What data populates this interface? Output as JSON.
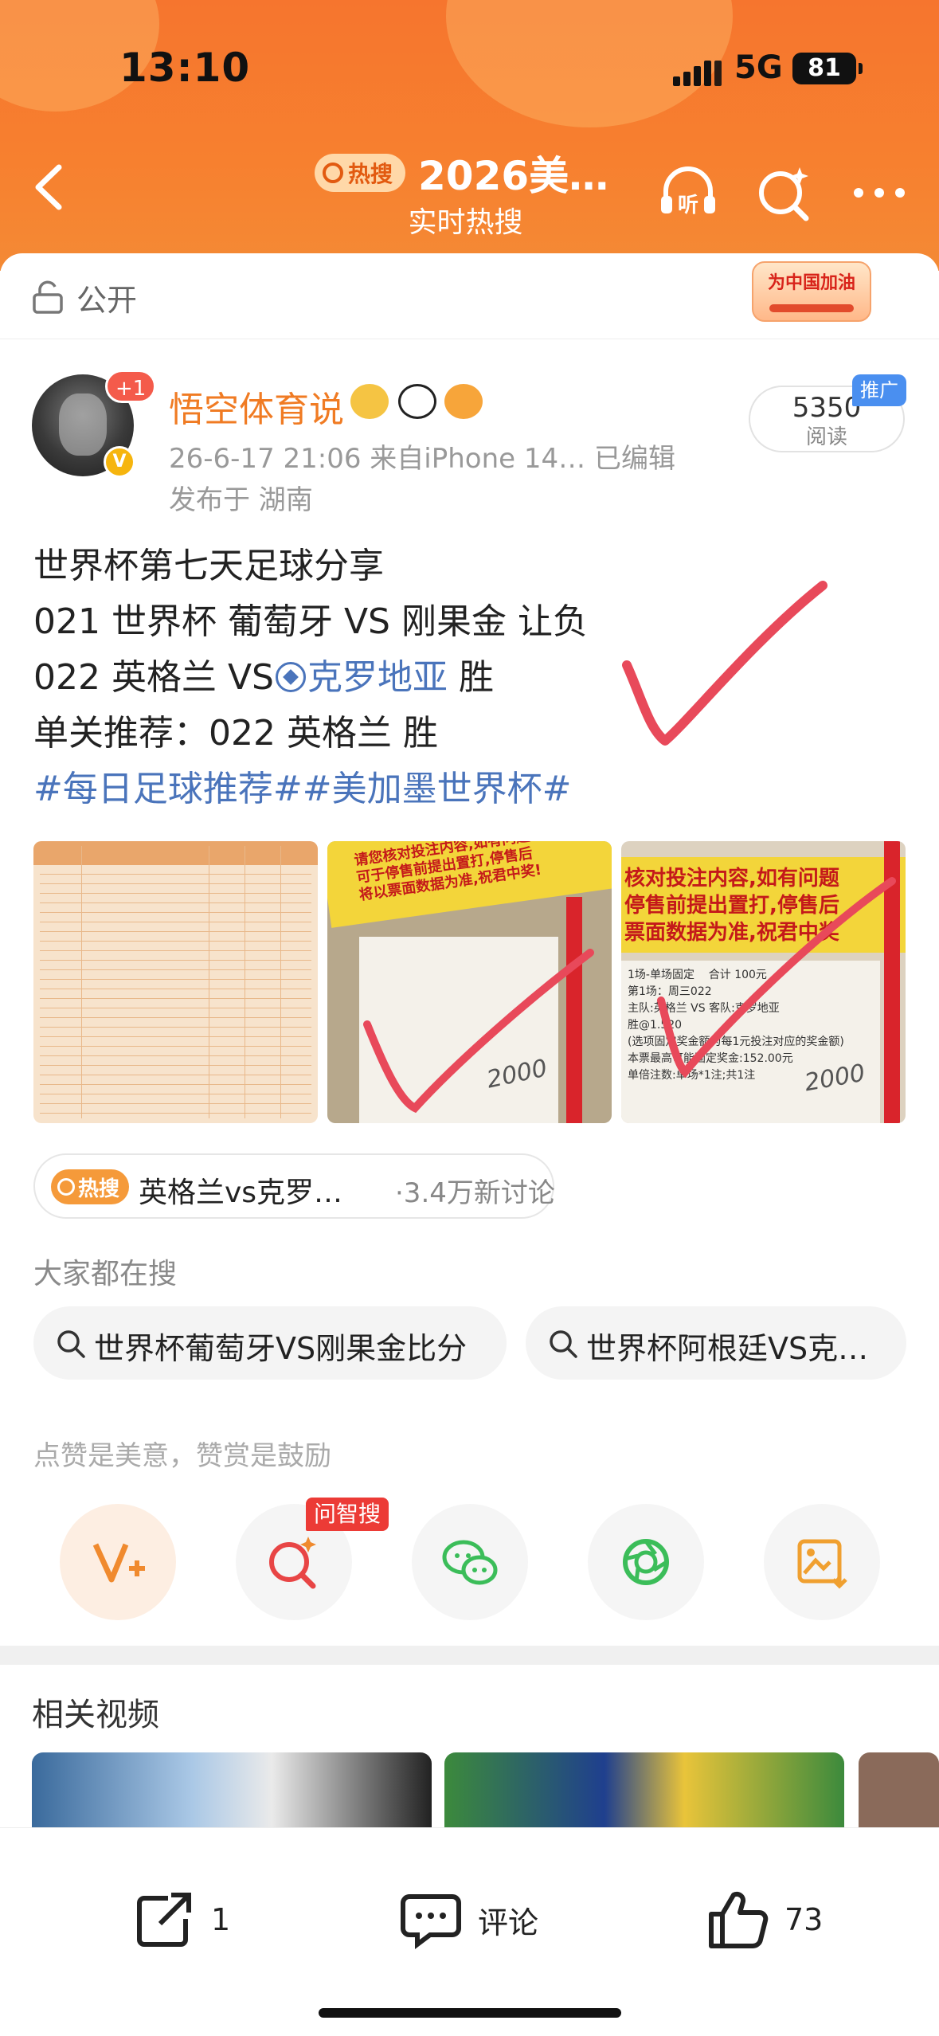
{
  "status_bar": {
    "time": "13:10",
    "network": "5G",
    "battery": "81"
  },
  "header": {
    "hot_badge": "热搜",
    "title": "2026美…",
    "subtitle": "实时热搜"
  },
  "visibility": {
    "label": "公开",
    "badge": "为中国加油"
  },
  "post": {
    "avatar_badge": "+1",
    "author": "悟空体育说",
    "meta": "26-6-17 21:06  来自iPhone 14…  已编辑",
    "location": "发布于 湖南",
    "reads_value": "5350",
    "reads_label": "阅读",
    "ad_label": "推广",
    "lines": {
      "l1": "世界杯第七天足球分享",
      "l2": "021 世界杯 葡萄牙 VS 刚果金 让负",
      "l3_pre": "022 英格兰 VS",
      "l3_link": "克罗地亚",
      "l3_post": " 胜",
      "l4": "单关推荐：022 英格兰 胜",
      "tags": "#每日足球推荐##美加墨世界杯#"
    },
    "images": {
      "ticket_banner_1": "请您核对投注内容,如有问题\n可于停售前提出置打,停售后\n将以票面数据为准,祝君中奖!",
      "ticket_banner_2": "核对投注内容,如有问题\n停售前提出置打,停售后\n票面数据为准,祝君中奖",
      "ticket_text_2": "1场-单场固定    合计 100元\n第1场：周三022\n主队:英格兰 VS 客队:克罗地亚\n胜@1.520\n(选项固定奖金额为每1元投注对应的奖金额)\n本票最高可能固定奖金:152.00元\n单倍注数:单场*1注;共1注",
      "ticket_total": "合计 100元",
      "handwritten": "2000"
    }
  },
  "topic": {
    "badge": "热搜",
    "text": "英格兰vs克罗…",
    "discussions": "·3.4万新讨论"
  },
  "search_section": {
    "label": "大家都在搜",
    "items": [
      "世界杯葡萄牙VS刚果金比分",
      "世界杯阿根廷VS克…"
    ]
  },
  "actions": {
    "label": "点赞是美意，赞赏是鼓励",
    "ai_tag": "问智搜",
    "buttons": [
      "reward-icon",
      "ai-search-icon",
      "wechat-icon",
      "moments-icon",
      "save-image-icon"
    ]
  },
  "related": {
    "label": "相关视频"
  },
  "bottom_bar": {
    "share_count": "1",
    "comment_label": "评论",
    "like_count": "73"
  },
  "colors": {
    "header": "#f6752e",
    "author": "#f07b23",
    "link": "#4a74bb",
    "check": "#e8495a"
  }
}
